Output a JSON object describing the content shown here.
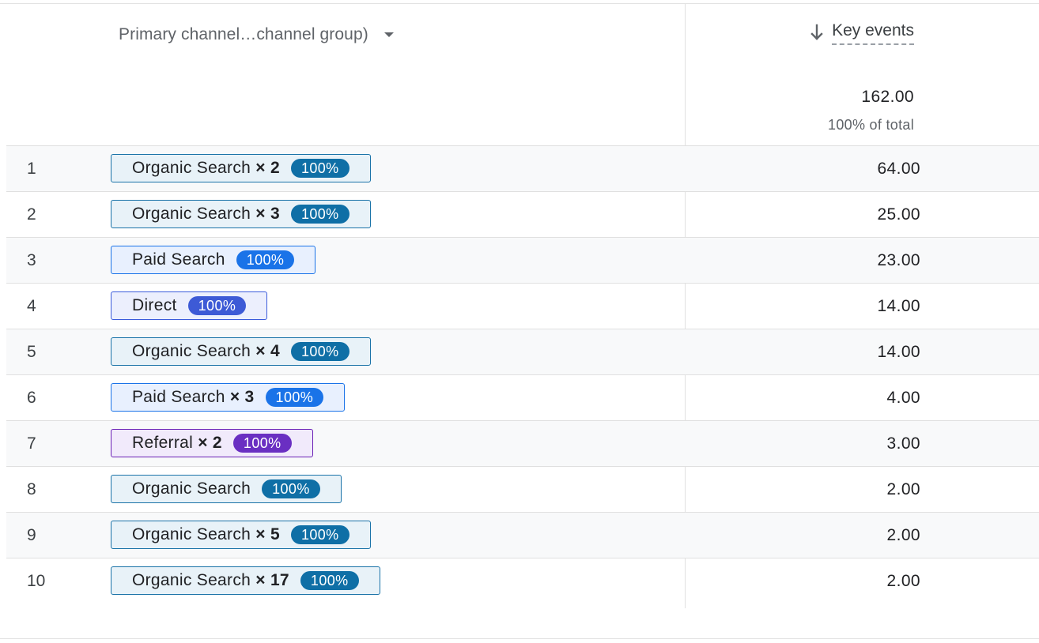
{
  "header": {
    "dimension_label": "Primary channel…channel group)",
    "metric_label": "Key events"
  },
  "totals": {
    "value": "162.00",
    "percent_of_total": "100% of total"
  },
  "colors": {
    "organic_border": "#1a73a8",
    "organic_bg": "#e8f2f8",
    "organic_badge": "#0f6fa6",
    "paid_border": "#1a73e8",
    "paid_bg": "#e8f0fe",
    "paid_badge": "#1a73e8",
    "direct_border": "#3b5bdb",
    "direct_bg": "#eceffd",
    "direct_badge": "#3d5ad6",
    "referral_border": "#6a1fb5",
    "referral_bg": "#f1eafb",
    "referral_badge": "#6a2fc2"
  },
  "rows": [
    {
      "index": "1",
      "channel": "Organic Search",
      "multiplier": "× 2",
      "badge": "100%",
      "value": "64.00",
      "kind": "organic"
    },
    {
      "index": "2",
      "channel": "Organic Search",
      "multiplier": "× 3",
      "badge": "100%",
      "value": "25.00",
      "kind": "organic"
    },
    {
      "index": "3",
      "channel": "Paid Search",
      "multiplier": "",
      "badge": "100%",
      "value": "23.00",
      "kind": "paid"
    },
    {
      "index": "4",
      "channel": "Direct",
      "multiplier": "",
      "badge": "100%",
      "value": "14.00",
      "kind": "direct"
    },
    {
      "index": "5",
      "channel": "Organic Search",
      "multiplier": "× 4",
      "badge": "100%",
      "value": "14.00",
      "kind": "organic"
    },
    {
      "index": "6",
      "channel": "Paid Search",
      "multiplier": "× 3",
      "badge": "100%",
      "value": "4.00",
      "kind": "paid"
    },
    {
      "index": "7",
      "channel": "Referral",
      "multiplier": "× 2",
      "badge": "100%",
      "value": "3.00",
      "kind": "referral"
    },
    {
      "index": "8",
      "channel": "Organic Search",
      "multiplier": "",
      "badge": "100%",
      "value": "2.00",
      "kind": "organic"
    },
    {
      "index": "9",
      "channel": "Organic Search",
      "multiplier": "× 5",
      "badge": "100%",
      "value": "2.00",
      "kind": "organic"
    },
    {
      "index": "10",
      "channel": "Organic Search",
      "multiplier": "× 17",
      "badge": "100%",
      "value": "2.00",
      "kind": "organic"
    }
  ]
}
